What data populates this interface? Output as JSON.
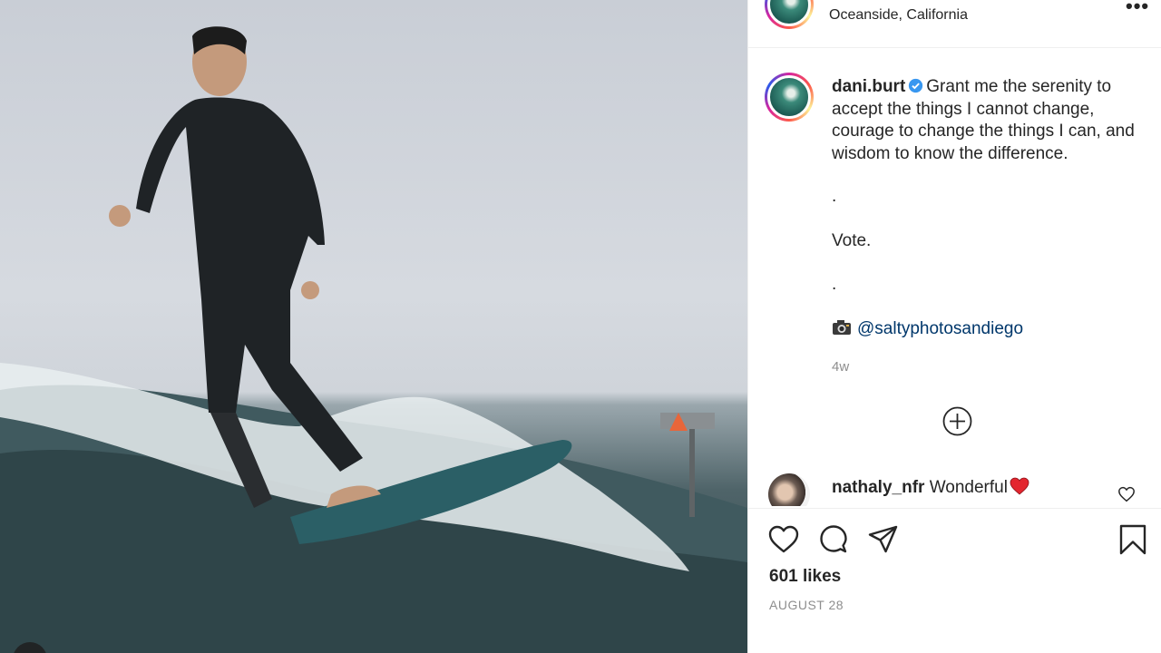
{
  "post": {
    "location": "Oceanside, California",
    "more_icon": "more-icon",
    "more_label": "•••",
    "author": "dani.burt",
    "verified": true,
    "caption_lines": [
      "Grant me the serenity to accept the things I cannot change, courage to change the things I can, and wisdom to know the difference.",
      ".",
      "Vote.",
      "."
    ],
    "credit_emoji": "camera-icon",
    "credit_handle": "@saltyphotosandiego",
    "time_ago": "4w",
    "load_more_icon": "plus-circle-icon"
  },
  "comment": {
    "user": "nathaly_nfr",
    "text": "Wonderful",
    "emoji": "red-heart-icon"
  },
  "actions": {
    "icons": [
      "heart-icon",
      "comment-icon",
      "share-icon",
      "bookmark-icon"
    ],
    "likes": "601 likes",
    "date": "AUGUST 28"
  },
  "colors": {
    "text": "#262626",
    "muted": "#8e8e8e",
    "link": "#00376b",
    "verified": "#3897f0",
    "heart": "#ed4956"
  }
}
